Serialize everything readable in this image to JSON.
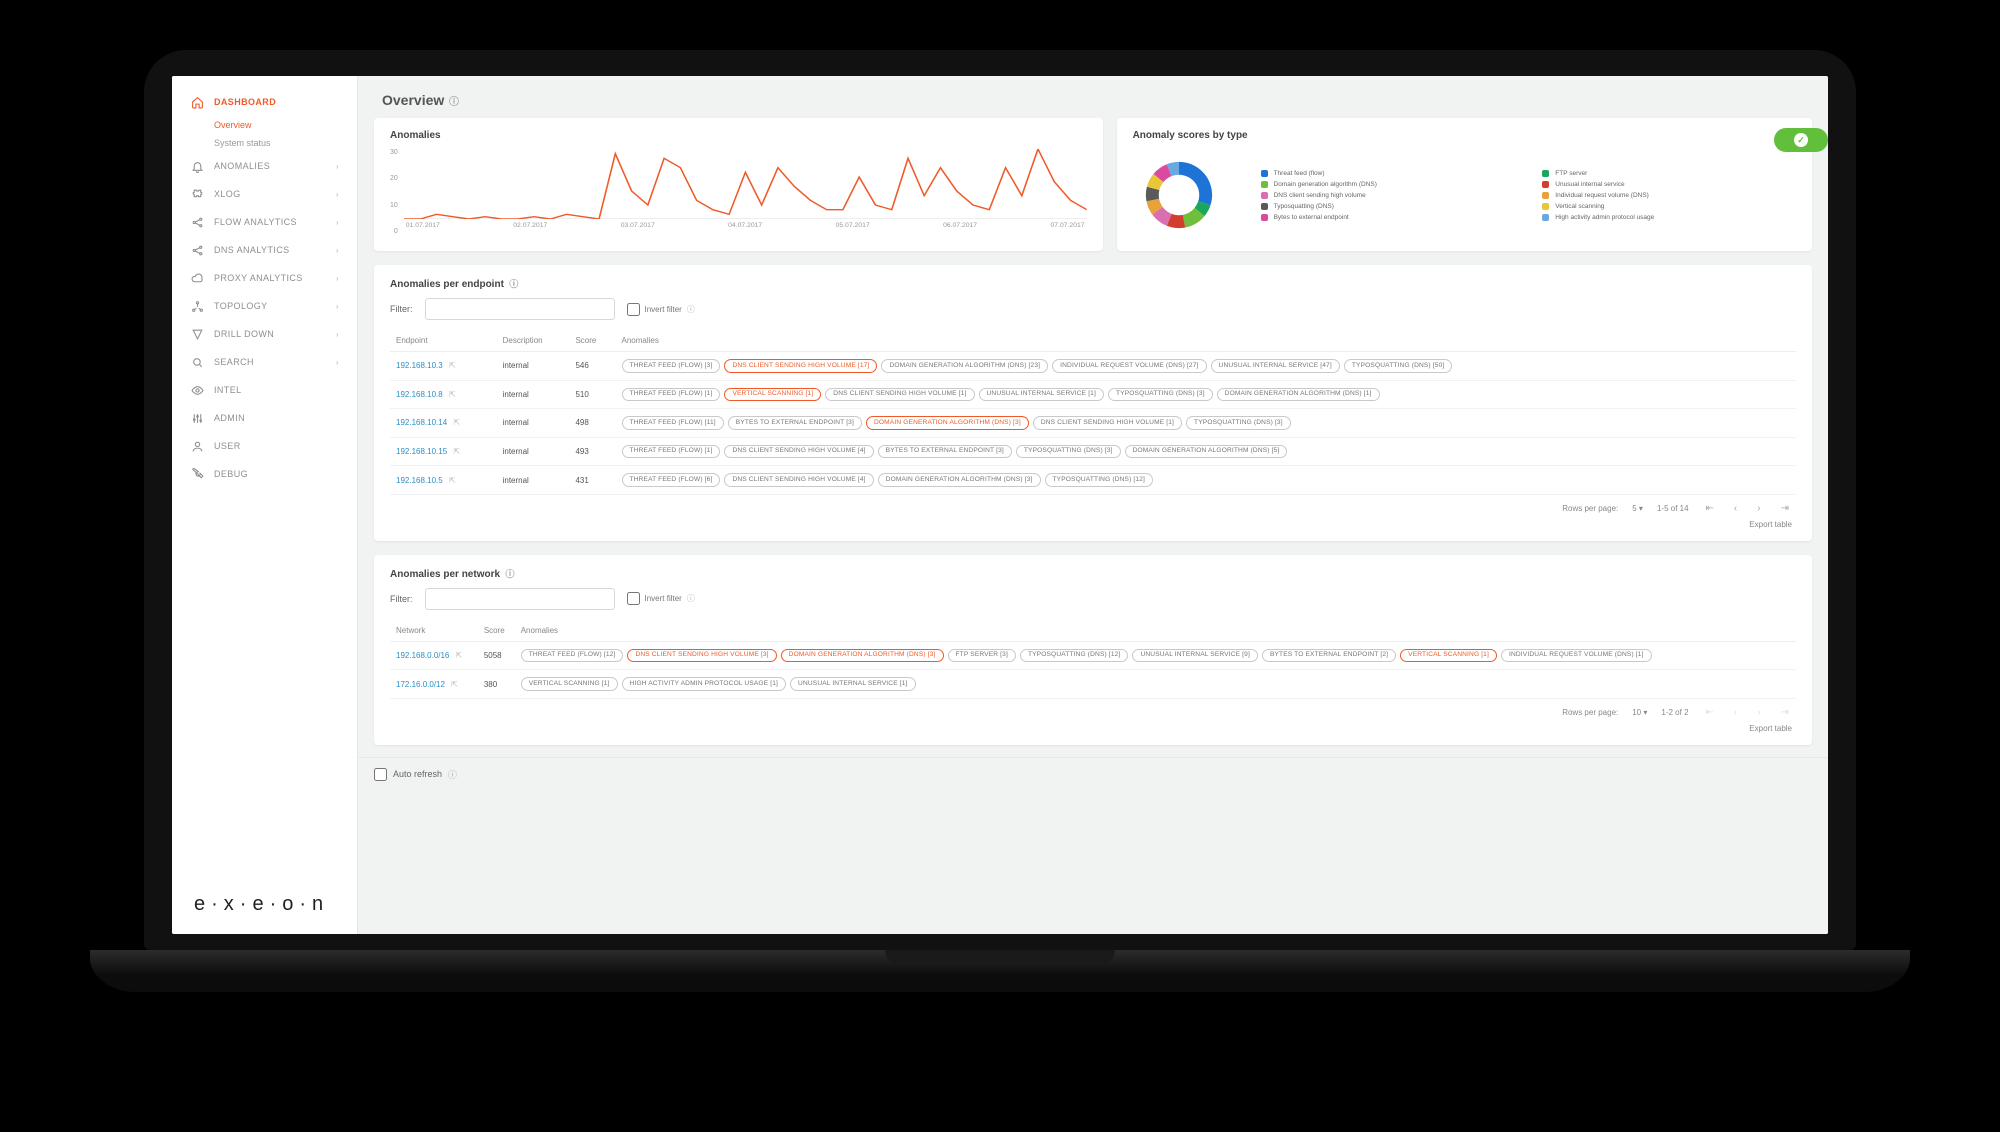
{
  "page": {
    "title": "Overview"
  },
  "sidebar": {
    "items": [
      {
        "id": "dashboard",
        "label": "DASHBOARD",
        "icon": "home",
        "active": true,
        "expand": false,
        "sub": [
          {
            "id": "overview",
            "label": "Overview",
            "active": true
          },
          {
            "id": "system-status",
            "label": "System status",
            "active": false
          }
        ]
      },
      {
        "id": "anomalies",
        "label": "ANOMALIES",
        "icon": "bell",
        "expand": true
      },
      {
        "id": "xlog",
        "label": "XLOG",
        "icon": "puzzle",
        "expand": true
      },
      {
        "id": "flow-analytics",
        "label": "FLOW ANALYTICS",
        "icon": "share",
        "expand": true
      },
      {
        "id": "dns-analytics",
        "label": "DNS ANALYTICS",
        "icon": "share",
        "expand": true
      },
      {
        "id": "proxy-analytics",
        "label": "PROXY ANALYTICS",
        "icon": "cloud",
        "expand": true
      },
      {
        "id": "topology",
        "label": "TOPOLOGY",
        "icon": "topology",
        "expand": true
      },
      {
        "id": "drill-down",
        "label": "DRILL DOWN",
        "icon": "drill",
        "expand": true
      },
      {
        "id": "search",
        "label": "SEARCH",
        "icon": "search",
        "expand": true
      },
      {
        "id": "intel",
        "label": "INTEL",
        "icon": "eye",
        "expand": false
      },
      {
        "id": "admin",
        "label": "ADMIN",
        "icon": "sliders",
        "expand": false
      },
      {
        "id": "user",
        "label": "USER",
        "icon": "user",
        "expand": false
      },
      {
        "id": "debug",
        "label": "DEBUG",
        "icon": "wrench",
        "expand": false
      }
    ],
    "brand": "e·x·e·o·n"
  },
  "strings": {
    "filter_label": "Filter:",
    "invert_filter": "Invert filter",
    "rows_per_page": "Rows per page:",
    "export_table": "Export table",
    "auto_refresh": "Auto refresh"
  },
  "cards": {
    "anomalies_title": "Anomalies",
    "donut_title": "Anomaly scores by type",
    "per_endpoint_title": "Anomalies per endpoint",
    "per_network_title": "Anomalies per network"
  },
  "chart_data": [
    {
      "type": "line",
      "title": "Anomalies",
      "xlabel": "",
      "ylabel": "",
      "ylim": [
        0,
        30
      ],
      "categories": [
        "01.07.2017",
        "02.07.2017",
        "03.07.2017",
        "04.07.2017",
        "05.07.2017",
        "06.07.2017",
        "07.07.2017"
      ],
      "y_ticks": [
        0,
        10,
        20,
        30
      ],
      "values": [
        0,
        0,
        2,
        1,
        0,
        1,
        0,
        0,
        1,
        0,
        2,
        1,
        0,
        28,
        12,
        6,
        26,
        22,
        8,
        4,
        2,
        20,
        6,
        22,
        14,
        8,
        4,
        4,
        18,
        6,
        4,
        26,
        10,
        22,
        12,
        6,
        4,
        22,
        10,
        30,
        16,
        8,
        4
      ]
    },
    {
      "type": "pie",
      "title": "Anomaly scores by type",
      "series": [
        {
          "name": "Threat feed (flow)",
          "value": 30,
          "color": "#1e73d6"
        },
        {
          "name": "FTP server",
          "value": 6,
          "color": "#19a85b"
        },
        {
          "name": "Domain generation algorithm (DNS)",
          "value": 11,
          "color": "#6fbf3b"
        },
        {
          "name": "Unusual internal service",
          "value": 9,
          "color": "#d23d2d"
        },
        {
          "name": "DNS client sending high volume",
          "value": 9,
          "color": "#d96fb1"
        },
        {
          "name": "Individual request volume (DNS)",
          "value": 7,
          "color": "#e8a23a"
        },
        {
          "name": "Typosquatting (DNS)",
          "value": 7,
          "color": "#5a5a5a"
        },
        {
          "name": "Vertical scanning",
          "value": 7,
          "color": "#e8c63a"
        },
        {
          "name": "Bytes to external endpoint",
          "value": 8,
          "color": "#d94aa0"
        },
        {
          "name": "High activity admin protocol usage",
          "value": 6,
          "color": "#6aa9e0"
        }
      ]
    }
  ],
  "endpoint_table": {
    "columns": [
      "Endpoint",
      "Description",
      "Score",
      "Anomalies"
    ],
    "page_size": 5,
    "range": "1-5 of 14",
    "rows": [
      {
        "endpoint": "192.168.10.3",
        "desc": "internal",
        "score": 546,
        "tags": [
          {
            "t": "THREAT FEED (FLOW) [3]"
          },
          {
            "t": "DNS CLIENT SENDING HIGH VOLUME [17]",
            "hot": true
          },
          {
            "t": "DOMAIN GENERATION ALGORITHM (DNS) [23]"
          },
          {
            "t": "INDIVIDUAL REQUEST VOLUME (DNS) [27]"
          },
          {
            "t": "UNUSUAL INTERNAL SERVICE [47]"
          },
          {
            "t": "TYPOSQUATTING (DNS) [50]"
          }
        ]
      },
      {
        "endpoint": "192.168.10.8",
        "desc": "internal",
        "score": 510,
        "tags": [
          {
            "t": "THREAT FEED (FLOW) [1]"
          },
          {
            "t": "VERTICAL SCANNING [1]",
            "hot": true
          },
          {
            "t": "DNS CLIENT SENDING HIGH VOLUME [1]"
          },
          {
            "t": "UNUSUAL INTERNAL SERVICE [1]"
          },
          {
            "t": "TYPOSQUATTING (DNS) [3]"
          },
          {
            "t": "DOMAIN GENERATION ALGORITHM (DNS) [1]"
          }
        ]
      },
      {
        "endpoint": "192.168.10.14",
        "desc": "internal",
        "score": 498,
        "tags": [
          {
            "t": "THREAT FEED (FLOW) [11]"
          },
          {
            "t": "BYTES TO EXTERNAL ENDPOINT [3]"
          },
          {
            "t": "DOMAIN GENERATION ALGORITHM (DNS) [3]",
            "hot": true
          },
          {
            "t": "DNS CLIENT SENDING HIGH VOLUME [1]"
          },
          {
            "t": "TYPOSQUATTING (DNS) [3]"
          }
        ]
      },
      {
        "endpoint": "192.168.10.15",
        "desc": "internal",
        "score": 493,
        "tags": [
          {
            "t": "THREAT FEED (FLOW) [1]"
          },
          {
            "t": "DNS CLIENT SENDING HIGH VOLUME [4]"
          },
          {
            "t": "BYTES TO EXTERNAL ENDPOINT [3]"
          },
          {
            "t": "TYPOSQUATTING (DNS) [3]"
          },
          {
            "t": "DOMAIN GENERATION ALGORITHM (DNS) [5]"
          }
        ]
      },
      {
        "endpoint": "192.168.10.5",
        "desc": "internal",
        "score": 431,
        "tags": [
          {
            "t": "THREAT FEED (FLOW) [6]"
          },
          {
            "t": "DNS CLIENT SENDING HIGH VOLUME [4]"
          },
          {
            "t": "DOMAIN GENERATION ALGORITHM (DNS) [3]"
          },
          {
            "t": "TYPOSQUATTING (DNS) [12]"
          }
        ]
      }
    ]
  },
  "network_table": {
    "columns": [
      "Network",
      "Score",
      "Anomalies"
    ],
    "page_size": 10,
    "range": "1-2 of 2",
    "rows": [
      {
        "network": "192.168.0.0/16",
        "score": 5058,
        "tags": [
          {
            "t": "THREAT FEED (FLOW) [12]"
          },
          {
            "t": "DNS CLIENT SENDING HIGH VOLUME [3]",
            "hot": true
          },
          {
            "t": "DOMAIN GENERATION ALGORITHM (DNS) [3]",
            "hot": true
          },
          {
            "t": "FTP SERVER [3]"
          },
          {
            "t": "TYPOSQUATTING (DNS) [12]"
          },
          {
            "t": "UNUSUAL INTERNAL SERVICE [9]"
          },
          {
            "t": "BYTES TO EXTERNAL ENDPOINT [2]"
          },
          {
            "t": "VERTICAL SCANNING [1]",
            "hot": true
          },
          {
            "t": "INDIVIDUAL REQUEST VOLUME (DNS) [1]"
          }
        ]
      },
      {
        "network": "172.16.0.0/12",
        "score": 380,
        "tags": [
          {
            "t": "VERTICAL SCANNING [1]"
          },
          {
            "t": "HIGH ACTIVITY ADMIN PROTOCOL USAGE [1]"
          },
          {
            "t": "UNUSUAL INTERNAL SERVICE [1]"
          }
        ]
      }
    ]
  }
}
